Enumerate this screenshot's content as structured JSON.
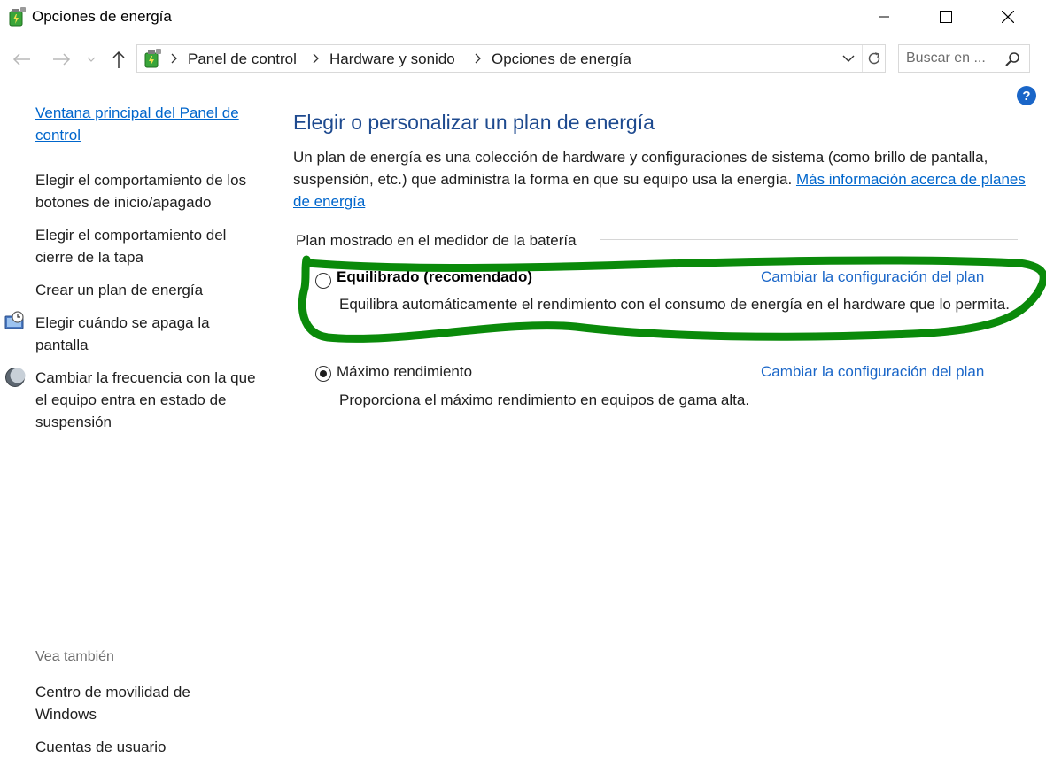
{
  "window": {
    "title": "Opciones de energía"
  },
  "address_bar": {
    "crumbs": [
      "Panel de control",
      "Hardware y sonido",
      "Opciones de energía"
    ]
  },
  "search": {
    "placeholder": "Buscar en ..."
  },
  "help": {
    "glyph": "?"
  },
  "sidebar": {
    "home_link": "Ventana principal del Panel de control",
    "items": [
      {
        "label": "Elegir el comportamiento de los botones de inicio/apagado",
        "icon": null
      },
      {
        "label": "Elegir el comportamiento del cierre de la tapa",
        "icon": null
      },
      {
        "label": "Crear un plan de energía",
        "icon": null
      },
      {
        "label": "Elegir cuándo se apaga la pantalla",
        "icon": "monitor-clock-icon"
      },
      {
        "label": "Cambiar la frecuencia con la que el equipo entra en estado de suspensión",
        "icon": "moon-icon"
      }
    ],
    "see_also_heading": "Vea también",
    "see_also": [
      {
        "label": "Centro de movilidad de Windows"
      },
      {
        "label": "Cuentas de usuario"
      }
    ]
  },
  "main": {
    "heading": "Elegir o personalizar un plan de energía",
    "description": "Un plan de energía es una colección de hardware y configuraciones de sistema (como brillo de pantalla, suspensión, etc.) que administra la forma en que su equipo usa la energía.",
    "more_info_link": "Más información acerca de planes de energía",
    "section_label": "Plan mostrado en el medidor de la batería",
    "plans": [
      {
        "name": "Equilibrado (recomendado)",
        "selected": false,
        "change_link": "Cambiar la configuración del plan",
        "description": "Equilibra automáticamente el rendimiento con el consumo de energía en el hardware que lo permita."
      },
      {
        "name": "Máximo rendimiento",
        "selected": true,
        "change_link": "Cambiar la configuración del plan",
        "description": "Proporciona el máximo rendimiento en equipos de gama alta."
      }
    ]
  },
  "colors": {
    "heading": "#1e4a8f",
    "link": "#0066cc",
    "annotation": "#0a8a0a"
  }
}
